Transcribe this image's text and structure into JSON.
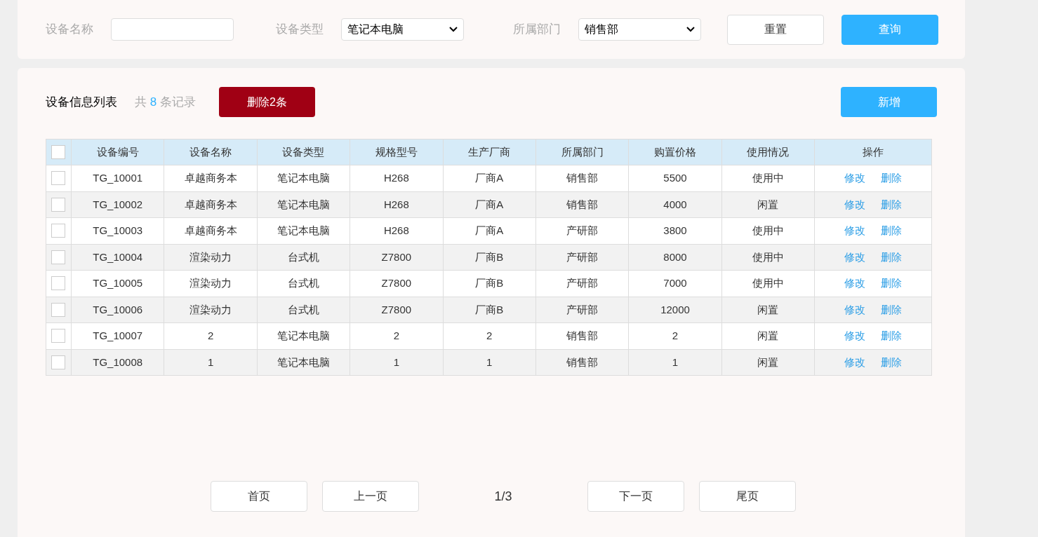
{
  "filters": [
    {
      "label": "设备名称",
      "kind": "text"
    },
    {
      "label": "设备类型",
      "kind": "select",
      "value": "笔记本电脑"
    },
    {
      "label": "所属部门",
      "kind": "select",
      "value": "销售部"
    }
  ],
  "filter_buttons": [
    {
      "label": "重置",
      "kind": "plain"
    },
    {
      "label": "查询",
      "kind": "primary"
    }
  ],
  "list": {
    "title": "设备信息列表",
    "count_prefix": "共",
    "count": "8",
    "count_suffix": "条记录",
    "delete_button": "删除2条",
    "add_button": "新增"
  },
  "table": {
    "select_all_checked": false,
    "columns": [
      "设备编号",
      "设备名称",
      "设备类型",
      "规格型号",
      "生产厂商",
      "所属部门",
      "购置价格",
      "使用情况",
      "操作"
    ],
    "rows": [
      {
        "checked": false,
        "cells": [
          "TG_10001",
          "卓越商务本",
          "笔记本电脑",
          "H268",
          "厂商A",
          "销售部",
          "5500",
          "使用中"
        ],
        "actions": [
          "修改",
          "删除"
        ]
      },
      {
        "checked": false,
        "cells": [
          "TG_10002",
          "卓越商务本",
          "笔记本电脑",
          "H268",
          "厂商A",
          "销售部",
          "4000",
          "闲置"
        ],
        "actions": [
          "修改",
          "删除"
        ]
      },
      {
        "checked": false,
        "cells": [
          "TG_10003",
          "卓越商务本",
          "笔记本电脑",
          "H268",
          "厂商A",
          "产研部",
          "3800",
          "使用中"
        ],
        "actions": [
          "修改",
          "删除"
        ]
      },
      {
        "checked": false,
        "cells": [
          "TG_10004",
          "渲染动力",
          "台式机",
          "Z7800",
          "厂商B",
          "产研部",
          "8000",
          "使用中"
        ],
        "actions": [
          "修改",
          "删除"
        ]
      },
      {
        "checked": false,
        "cells": [
          "TG_10005",
          "渲染动力",
          "台式机",
          "Z7800",
          "厂商B",
          "产研部",
          "7000",
          "使用中"
        ],
        "actions": [
          "修改",
          "删除"
        ]
      },
      {
        "checked": false,
        "cells": [
          "TG_10006",
          "渲染动力",
          "台式机",
          "Z7800",
          "厂商B",
          "产研部",
          "12000",
          "闲置"
        ],
        "actions": [
          "修改",
          "删除"
        ]
      },
      {
        "checked": false,
        "cells": [
          "TG_10007",
          "2",
          "笔记本电脑",
          "2",
          "2",
          "销售部",
          "2",
          "闲置"
        ],
        "actions": [
          "修改",
          "删除"
        ]
      },
      {
        "checked": false,
        "cells": [
          "TG_10008",
          "1",
          "笔记本电脑",
          "1",
          "1",
          "销售部",
          "1",
          "闲置"
        ],
        "actions": [
          "修改",
          "删除"
        ]
      }
    ]
  },
  "pagination": {
    "buttons_before": [
      "首页",
      "上一页"
    ],
    "page": "1/3",
    "buttons_after": [
      "下一页",
      "尾页"
    ]
  }
}
